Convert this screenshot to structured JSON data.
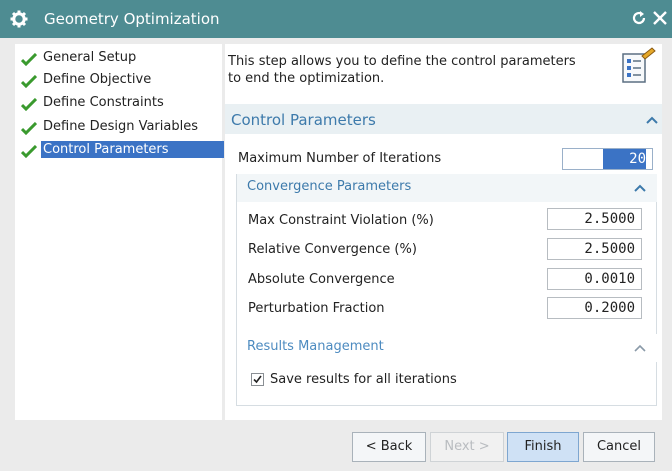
{
  "window": {
    "title": "Geometry Optimization"
  },
  "nav": {
    "items": [
      {
        "label": "General Setup",
        "done": true,
        "selected": false
      },
      {
        "label": "Define Objective",
        "done": true,
        "selected": false
      },
      {
        "label": "Define Constraints",
        "done": true,
        "selected": false
      },
      {
        "label": "Define Design Variables",
        "done": true,
        "selected": false
      },
      {
        "label": "Control Parameters",
        "done": true,
        "selected": true
      }
    ]
  },
  "intro": {
    "text": "This step allows you to define the control parameters to end the optimization."
  },
  "control": {
    "title": "Control Parameters",
    "max_iter_label": "Maximum Number of Iterations",
    "max_iter_value": "20"
  },
  "convergence": {
    "title": "Convergence Parameters",
    "rows": [
      {
        "label": "Max Constraint Violation (%)",
        "value": "2.5000"
      },
      {
        "label": "Relative Convergence (%)",
        "value": "2.5000"
      },
      {
        "label": "Absolute Convergence",
        "value": "0.0010"
      },
      {
        "label": "Perturbation Fraction",
        "value": "0.2000"
      }
    ]
  },
  "results": {
    "title": "Results Management",
    "save_all_label": "Save results for all iterations",
    "save_all_checked": true
  },
  "buttons": {
    "back": "< Back",
    "next": "Next >",
    "finish": "Finish",
    "cancel": "Cancel"
  },
  "colors": {
    "titlebar": "#4e8c92",
    "accent": "#3d7aab",
    "selection": "#3b73c5",
    "check": "#3a9a2e"
  }
}
